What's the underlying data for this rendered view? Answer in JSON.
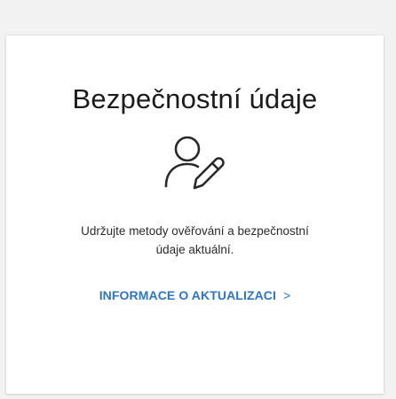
{
  "card": {
    "title": "Bezpečnostní údaje",
    "icon": "user-edit-icon",
    "description_line1": "Udržujte metody ověřování a bezpečnostní",
    "description_line2": "údaje aktuální.",
    "link_label": "INFORMACE O AKTUALIZACI",
    "link_chevron": ">"
  },
  "colors": {
    "background": "#f2f2f2",
    "card": "#ffffff",
    "title_text": "#1b1b1b",
    "link": "#2f74c6"
  }
}
